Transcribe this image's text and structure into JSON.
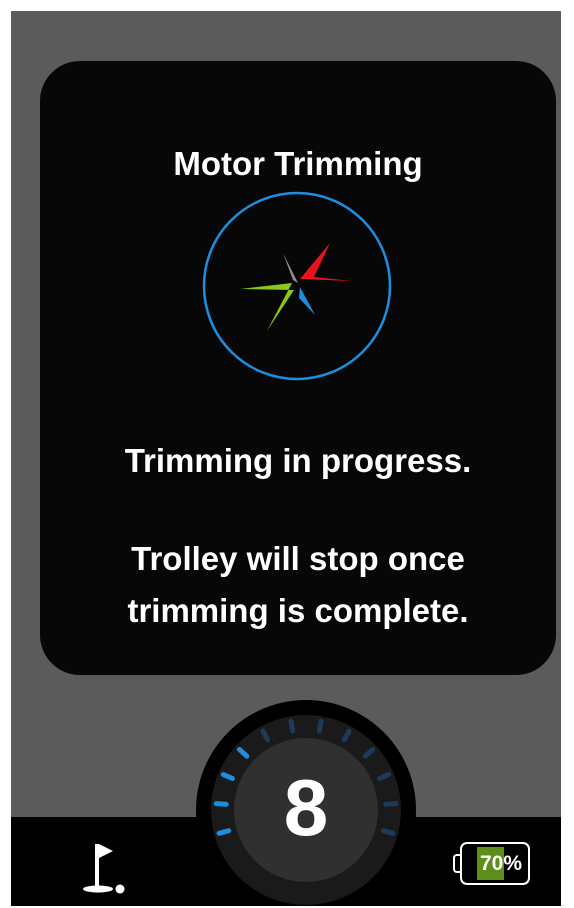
{
  "modal": {
    "title": "Motor Trimming",
    "status_line": "Trimming in progress.",
    "info_line_1": "Trolley will stop once",
    "info_line_2": "trimming is complete."
  },
  "speed_dial": {
    "gear": "8"
  },
  "status_bar": {
    "battery_text": "70%",
    "battery_level": 0.7
  },
  "colors": {
    "accent_blue": "#1c8fe0",
    "battery_green": "#5c8f1a",
    "logo_red": "#e8141b",
    "logo_green": "#8cc819",
    "logo_grey": "#8c8c8c"
  },
  "icons": {
    "logo": "compass-star-logo",
    "golf": "golf-flag-icon",
    "battery": "battery-icon"
  }
}
